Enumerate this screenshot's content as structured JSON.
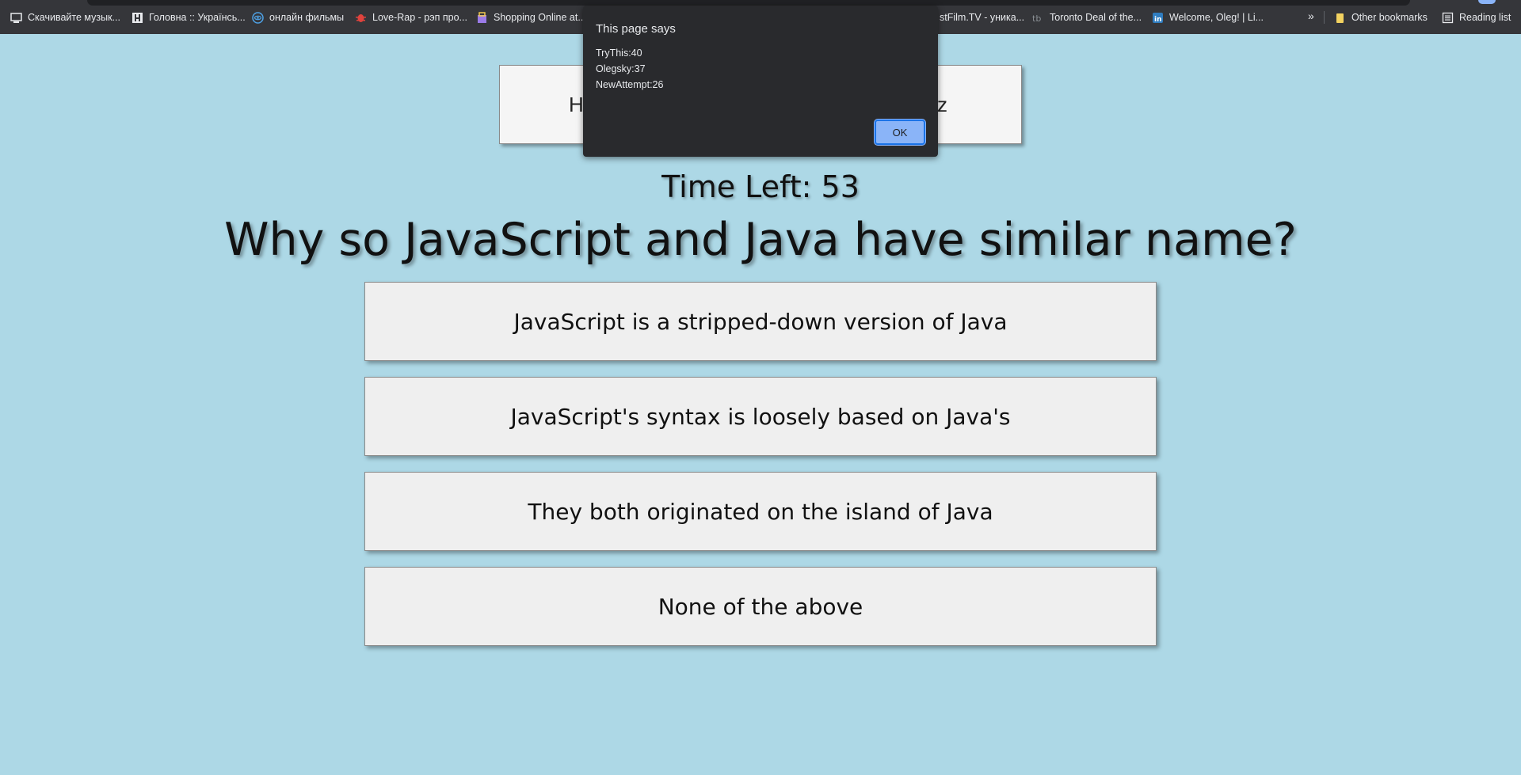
{
  "bookmarks": {
    "items": [
      {
        "label": "Скачивайте музык...",
        "icon": "monitor-icon"
      },
      {
        "label": "Головна :: Українсь...",
        "icon": "h-square-icon"
      },
      {
        "label": "онлайн фильмы",
        "icon": "eye-globe-icon"
      },
      {
        "label": "Love-Rap - рэп про...",
        "icon": "bug-icon"
      },
      {
        "label": "Shopping Online at...",
        "icon": "store-icon"
      },
      {
        "label": "stFilm.TV - уника...",
        "icon": ""
      },
      {
        "label": "Toronto Deal of the...",
        "icon": "tb-icon"
      },
      {
        "label": "Welcome, Oleg! | Li...",
        "icon": "linkedin-icon"
      }
    ],
    "overflow": "»",
    "other_bookmarks": "Other bookmarks",
    "reading_list": "Reading list"
  },
  "quiz": {
    "highscores_left": "H",
    "highscores_right": "z",
    "timer": "Time Left: 53",
    "question": "Why so JavaScript and Java have similar name?",
    "answers": [
      "JavaScript is a stripped-down version of Java",
      "JavaScript's syntax is loosely based on Java's",
      "They both originated on the island of Java",
      "None of the above"
    ]
  },
  "alert": {
    "title": "This page says",
    "lines": [
      "TryThis:40",
      "Olegsky:37",
      "NewAttempt:26"
    ],
    "ok_label": "OK"
  },
  "colors": {
    "page_background": "#add8e6",
    "button_background": "#efefef",
    "dialog_background": "#292a2d",
    "ok_button": "#8ab4f8"
  }
}
